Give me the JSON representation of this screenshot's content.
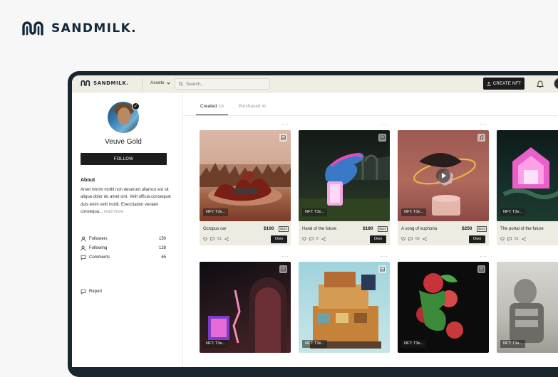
{
  "brand": {
    "name": "SANDMILK."
  },
  "topbar": {
    "logo": "SANDMILK.",
    "assets_label": "Assets",
    "search_placeholder": "Search...",
    "create_label": "CREATE NFT"
  },
  "profile": {
    "name": "Veuve Gold",
    "follow_label": "FOLLOW",
    "about_heading": "About",
    "about_text": "Amet minim mollit non deserunt ullamco est sit aliqua dolor do amet sint. Velit officia consequat duis enim velit mollit. Exercitation veniam consequa...",
    "read_more": "read more",
    "stats": [
      {
        "label": "Followers",
        "value": "150",
        "icon": "user-icon"
      },
      {
        "label": "Following",
        "value": "128",
        "icon": "user-check-icon"
      },
      {
        "label": "Comments",
        "value": "65",
        "icon": "comment-icon"
      }
    ],
    "report_label": "Report"
  },
  "tabs": [
    {
      "label": "Created",
      "count": "126"
    },
    {
      "label": "Purchased",
      "count": "45"
    }
  ],
  "cards": [
    {
      "tag": "NFT: T3e...",
      "name": "Octopus car",
      "price": "$100",
      "bid": "$510",
      "likes": "",
      "comments": "51",
      "own": "Own",
      "type": "image-icon"
    },
    {
      "tag": "NFT: T3e...",
      "name": "Hand of the future",
      "price": "$180",
      "bid": "$510",
      "likes": "",
      "comments": "8",
      "own": "Own",
      "type": "image-icon"
    },
    {
      "tag": "NFT: T3e...",
      "name": "A song of euphoria",
      "price": "$250",
      "bid": "$510",
      "likes": "",
      "comments": "60",
      "own": "Own",
      "type": "music-icon"
    },
    {
      "tag": "NFT: T3e...",
      "name": "The portal of the future",
      "price": "",
      "bid": "",
      "likes": "",
      "comments": "51",
      "own": "",
      "type": "image-icon"
    },
    {
      "tag": "NFT: T3e...",
      "type": "image-icon"
    },
    {
      "tag": "NFT: T3e...",
      "type": "image-icon"
    },
    {
      "tag": "NFT: T3e...",
      "type": "image-icon"
    },
    {
      "tag": "NFT: T3e...",
      "type": "image-icon"
    }
  ]
}
